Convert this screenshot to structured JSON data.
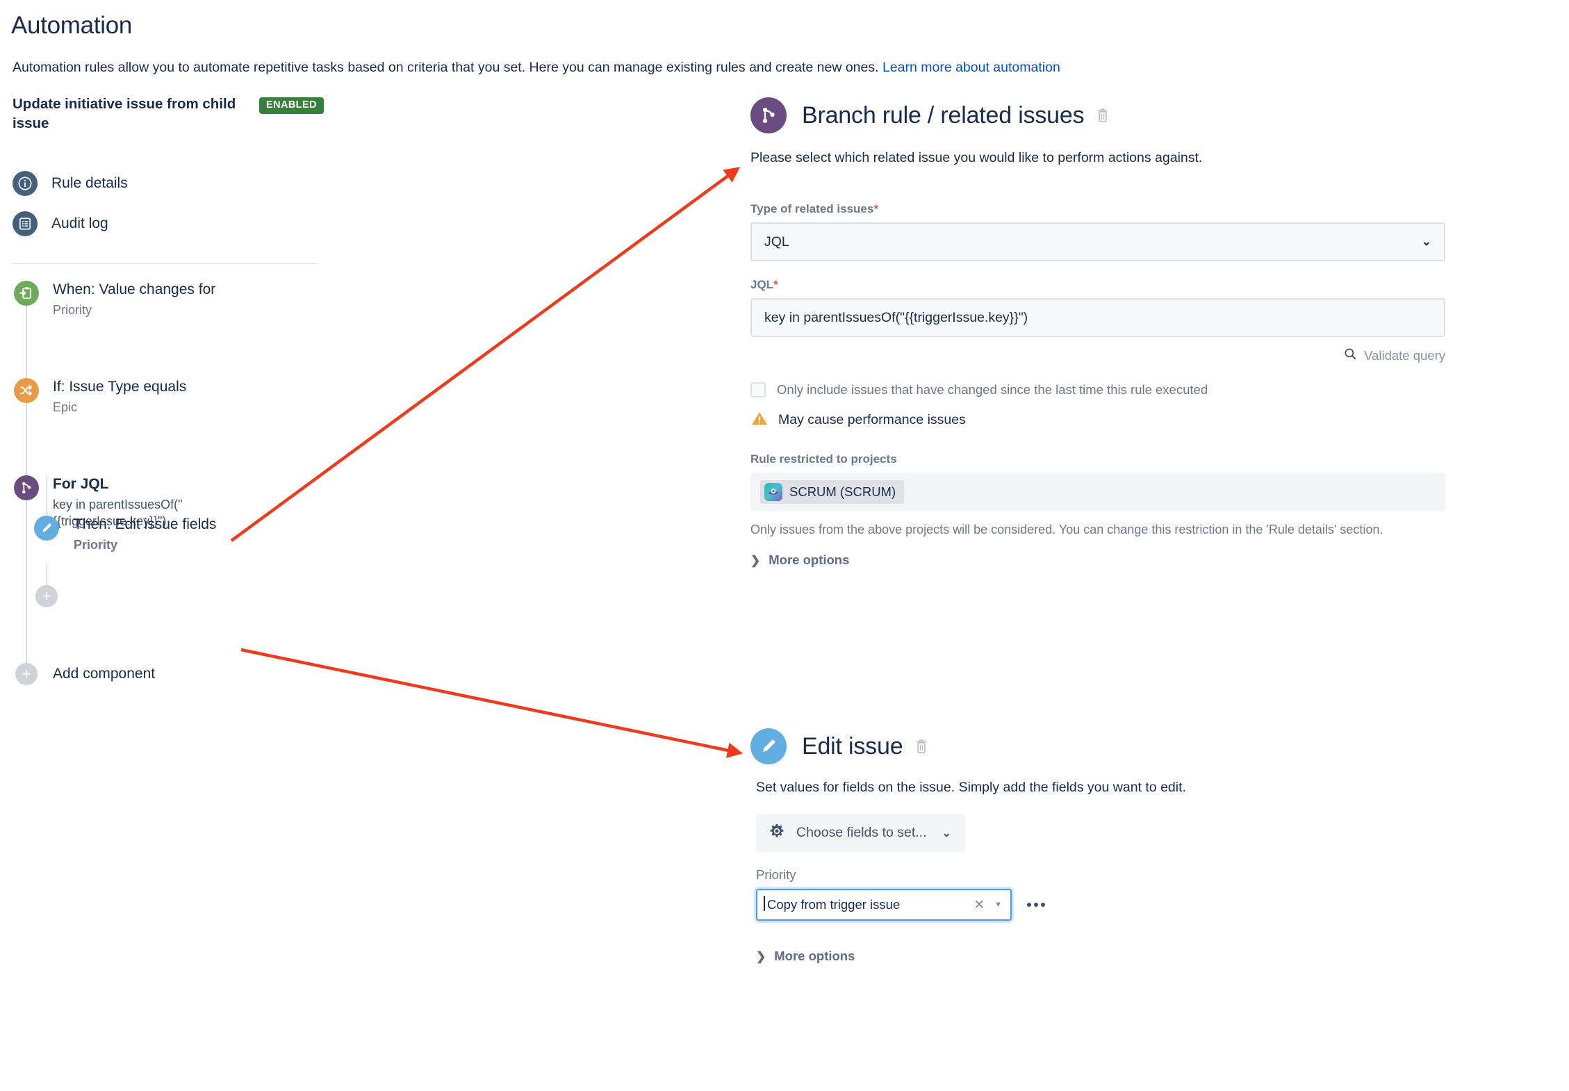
{
  "header": {
    "title": "Automation",
    "description": "Automation rules allow you to automate repetitive tasks based on criteria that you set. Here you can manage existing rules and create new ones.",
    "learn_more_link": "Learn more about automation"
  },
  "rule": {
    "name": "Update initiative issue from child issue",
    "status_badge": "ENABLED"
  },
  "nav": {
    "items": [
      {
        "label": "Rule details",
        "icon": "info-circle-icon"
      },
      {
        "label": "Audit log",
        "icon": "list-document-icon"
      }
    ]
  },
  "chain": {
    "nodes": [
      {
        "title": "When: Value changes for",
        "subtitle": "Priority",
        "icon": "trigger-clipboard-icon",
        "color": "#6FA95A"
      },
      {
        "title": "If: Issue Type equals",
        "subtitle": "Epic",
        "icon": "shuffle-condition-icon",
        "color": "#E89B46"
      },
      {
        "title": "For JQL",
        "subtitle": "key in parentIssuesOf(\"{{triggerIssue.key}}\")",
        "icon": "branch-icon",
        "color": "#6B4C80"
      },
      {
        "title": "Then: Edit issue fields",
        "subtitle": "Priority",
        "icon": "pencil-edit-icon",
        "color": "#63AEE0"
      }
    ],
    "add_component_label": "Add component"
  },
  "branch_panel": {
    "title": "Branch rule / related issues",
    "description": "Please select which related issue you would like to perform actions against.",
    "type_label": "Type of related issues",
    "type_value": "JQL",
    "jql_label": "JQL",
    "jql_value": "key in parentIssuesOf(\"{{triggerIssue.key}}\")",
    "validate_query_label": "Validate query",
    "checkbox_label": "Only include issues that have changed since the last time this rule executed",
    "checkbox_checked": false,
    "warning_label": "May cause performance issues",
    "restricted_label": "Rule restricted to projects",
    "project_chip": "SCRUM (SCRUM)",
    "helper_text": "Only issues from the above projects will be considered. You can change this restriction in the 'Rule details' section.",
    "more_options_label": "More options"
  },
  "edit_issue_panel": {
    "title": "Edit issue",
    "description": "Set values for fields on the issue. Simply add the fields you want to edit.",
    "choose_fields_label": "Choose fields to set...",
    "priority_label": "Priority",
    "priority_value": "Copy from trigger issue",
    "more_options_label": "More options"
  },
  "colors": {
    "accent_link": "#0052CC",
    "badge_green": "#36803B",
    "branch_purple": "#6B4C80",
    "edit_blue": "#63AEE0",
    "trigger_green": "#6FA95A",
    "condition_orange": "#E89B46",
    "nav_slate": "#44607D",
    "annotation_red": "#EE3B1E",
    "required_red": "#DE5B48",
    "warning_amber": "#F2A33C"
  }
}
